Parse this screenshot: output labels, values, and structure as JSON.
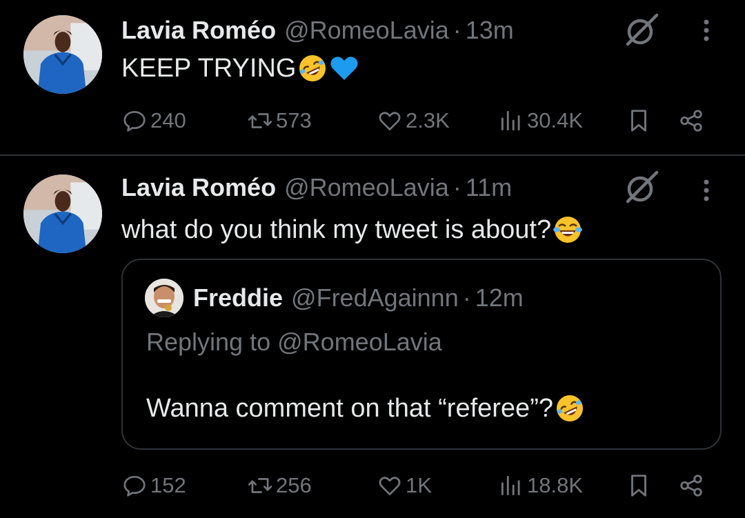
{
  "colors": {
    "background": "#000000",
    "text": "#e7e9ea",
    "muted": "#71767b",
    "divider": "#2f3336",
    "heart_emoji": "#1d9bf0"
  },
  "tweets": [
    {
      "author_name": "Lavia Roméo",
      "handle": "@RomeoLavia",
      "separator": "·",
      "time": "13m",
      "text": "KEEP TRYING",
      "emojis": [
        "rolling-on-floor-laughing",
        "blue-heart"
      ],
      "stats": {
        "replies": "240",
        "reposts": "573",
        "likes": "2.3K",
        "views": "30.4K"
      }
    },
    {
      "author_name": "Lavia Roméo",
      "handle": "@RomeoLavia",
      "separator": "·",
      "time": "11m",
      "text": "what do you think my tweet is about?",
      "emojis": [
        "face-with-tears-of-joy"
      ],
      "quote": {
        "author_name": "Freddie",
        "handle": "@FredAgainnn",
        "separator": "·",
        "time": "12m",
        "replying_prefix": "Replying to",
        "replying_to": "@RomeoLavia",
        "text": "Wanna comment on that “referee”?",
        "emojis": [
          "rolling-on-floor-laughing"
        ]
      },
      "stats": {
        "replies": "152",
        "reposts": "256",
        "likes": "1K",
        "views": "18.8K"
      }
    }
  ]
}
